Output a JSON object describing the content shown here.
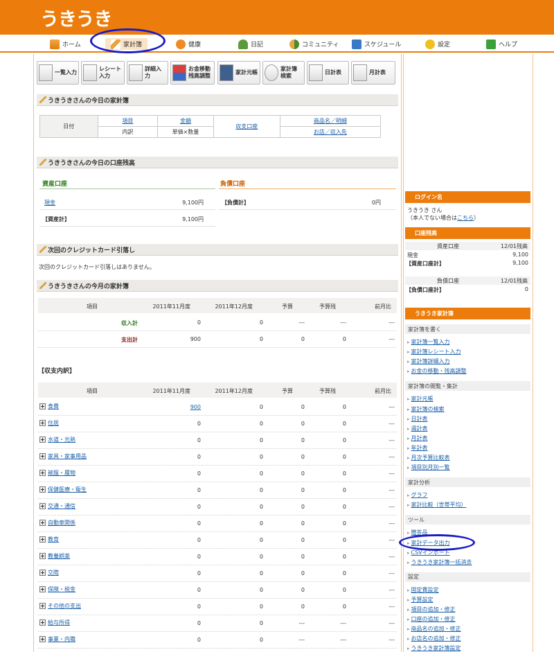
{
  "header": {
    "logo": "うきうき"
  },
  "nav": [
    {
      "label": "ホーム",
      "icon": "home-icon"
    },
    {
      "label": "家計簿",
      "icon": "pencil-icon",
      "active": true
    },
    {
      "label": "健康",
      "icon": "heart-icon"
    },
    {
      "label": "日記",
      "icon": "person-icon"
    },
    {
      "label": "コミュニティ",
      "icon": "community-icon"
    },
    {
      "label": "スケジュール",
      "icon": "calendar-icon"
    },
    {
      "label": "設定",
      "icon": "star-icon"
    },
    {
      "label": "ヘルプ",
      "icon": "help-icon"
    }
  ],
  "toolbar": [
    "一覧入力",
    "レシート入力",
    "詳細入力",
    "お金移動\n残高調整",
    "家計元帳",
    "家計簿\n検索",
    "日計表",
    "月計表"
  ],
  "today": {
    "title": "うきうきさんの今日の家計簿",
    "date_label": "日付",
    "item": "項目",
    "breakdown": "内訳",
    "amount": "金額",
    "unit": "単価×数量",
    "account": "収支口座",
    "product": "商品名／明細",
    "shop": "お店／収入先"
  },
  "balance": {
    "title": "うきうきさんの今日の口座残高",
    "assets_heading": "資産口座",
    "liab_heading": "負債口座",
    "cash_label": "現金",
    "cash_value": "9,100円",
    "asset_total_label": "【資産計】",
    "asset_total_value": "9,100円",
    "liab_total_label": "【負債計】",
    "liab_total_value": "0円"
  },
  "credit": {
    "title": "次回のクレジットカード引落し",
    "message": "次回のクレジットカード引落しはありません。"
  },
  "month": {
    "title": "うきうきさんの今月の家計簿",
    "columns": [
      "項目",
      "2011年11月度",
      "2011年12月度",
      "予算",
      "予算残",
      "前月比"
    ],
    "income": [
      "収入計",
      "0",
      "0",
      "---",
      "---",
      "---"
    ],
    "expense": [
      "支出計",
      "900",
      "0",
      "0",
      "0",
      "---"
    ],
    "breakdown_title": "【収支内訳】",
    "rows": [
      [
        "食費",
        "900",
        "0",
        "0",
        "0",
        "---"
      ],
      [
        "住居",
        "0",
        "0",
        "0",
        "0",
        "---"
      ],
      [
        "水道・光熱",
        "0",
        "0",
        "0",
        "0",
        "---"
      ],
      [
        "家具・家事用品",
        "0",
        "0",
        "0",
        "0",
        "---"
      ],
      [
        "被服・履物",
        "0",
        "0",
        "0",
        "0",
        "---"
      ],
      [
        "保健医療・衛生",
        "0",
        "0",
        "0",
        "0",
        "---"
      ],
      [
        "交通・通信",
        "0",
        "0",
        "0",
        "0",
        "---"
      ],
      [
        "自動車関係",
        "0",
        "0",
        "0",
        "0",
        "---"
      ],
      [
        "教育",
        "0",
        "0",
        "0",
        "0",
        "---"
      ],
      [
        "教養娯楽",
        "0",
        "0",
        "0",
        "0",
        "---"
      ],
      [
        "交際",
        "0",
        "0",
        "0",
        "0",
        "---"
      ],
      [
        "保険・税金",
        "0",
        "0",
        "0",
        "0",
        "---"
      ],
      [
        "その他の支出",
        "0",
        "0",
        "0",
        "0",
        "---"
      ],
      [
        "給与所得",
        "0",
        "0",
        "---",
        "---",
        "---"
      ],
      [
        "事業・内職",
        "0",
        "0",
        "---",
        "---",
        "---"
      ]
    ]
  },
  "sidebar": {
    "login_title": "ログイン名",
    "login_name": "うきうき さん",
    "login_note_prefix": "（本人でない場合は",
    "login_note_link": "こちら",
    "login_note_suffix": "）",
    "acct_title": "口座残高",
    "acct_assets_head": "資産口座",
    "acct_assets_date": "12/01残高",
    "acct_cash": "現金",
    "acct_cash_val": "9,100",
    "acct_asset_total": "【資産口座計】",
    "acct_asset_total_val": "9,100",
    "acct_liab_head": "負債口座",
    "acct_liab_date": "12/01残高",
    "acct_liab_total": "【負債口座計】",
    "acct_liab_total_val": "0",
    "kakeibo_title": "うきうき家計簿",
    "groups": [
      {
        "label": "家計簿を書く",
        "links": [
          "家計簿一覧入力",
          "家計簿レシート入力",
          "家計簿詳細入力",
          "お金の移動・残高調整"
        ]
      },
      {
        "label": "家計簿の閲覧・集計",
        "links": [
          "家計元帳",
          "家計簿の検索",
          "日計表",
          "週計表",
          "月計表",
          "年計表",
          "月次予算比較表",
          "項目別月別一覧"
        ]
      },
      {
        "label": "家計分析",
        "links": [
          "グラフ",
          "家計比較（世帯平均）"
        ]
      },
      {
        "label": "ツール",
        "links": [
          "贈答品",
          "家計データ出力",
          "CSVインポート",
          "うきうき家計簿一括消去"
        ]
      },
      {
        "label": "設定",
        "links": [
          "固定費設定",
          "予算設定",
          "項目の追加・修正",
          "口座の追加・修正",
          "商品名の追加・修正",
          "お店名の追加・修正",
          "うきうき家計簿設定"
        ]
      }
    ]
  }
}
